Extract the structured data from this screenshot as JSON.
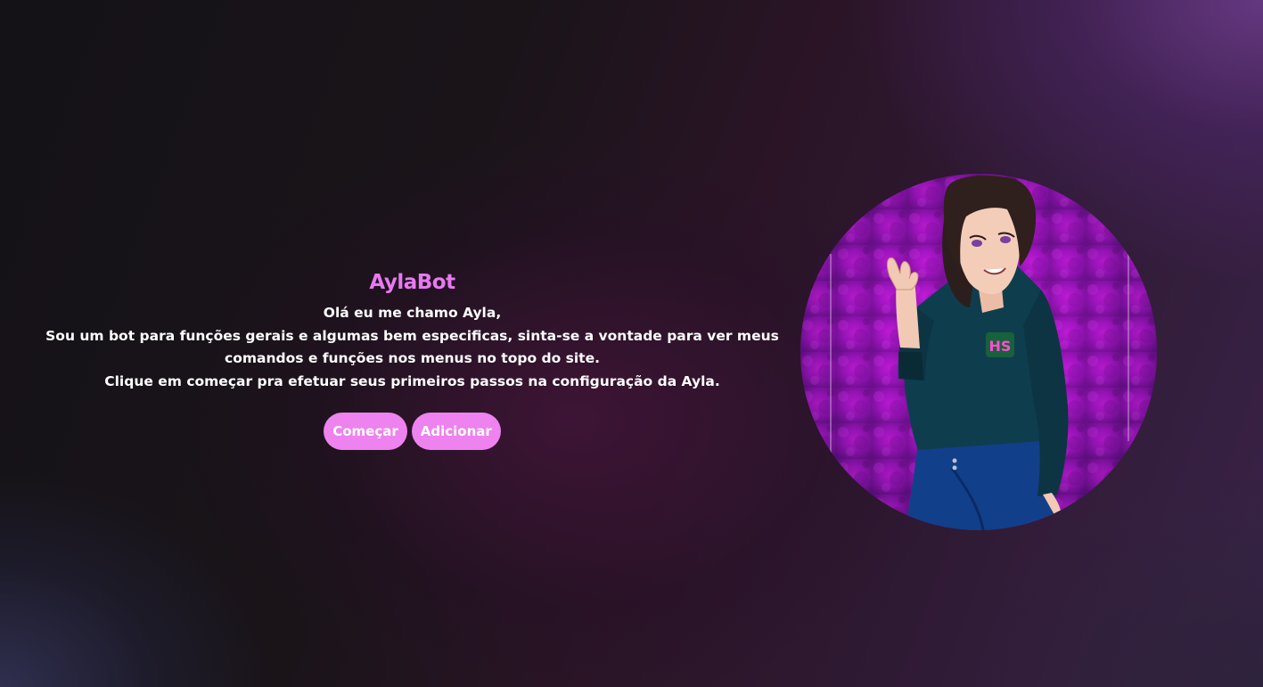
{
  "hero": {
    "title": "AylaBot",
    "description_lines": [
      "Olá eu me chamo Ayla,",
      "Sou um bot para funções gerais e algumas bem especificas, sinta-se a vontade para ver meus",
      "comandos e funções nos menus no topo do site.",
      "Clique em começar pra efetuar seus primeiros passos na configuração da Ayla."
    ],
    "buttons": {
      "start_label": "Começar",
      "add_label": "Adicionar"
    }
  },
  "avatar": {
    "badge_text": "HS"
  },
  "colors": {
    "accent": "#ee82ee",
    "title": "#e879f0",
    "text": "#ffffff"
  }
}
